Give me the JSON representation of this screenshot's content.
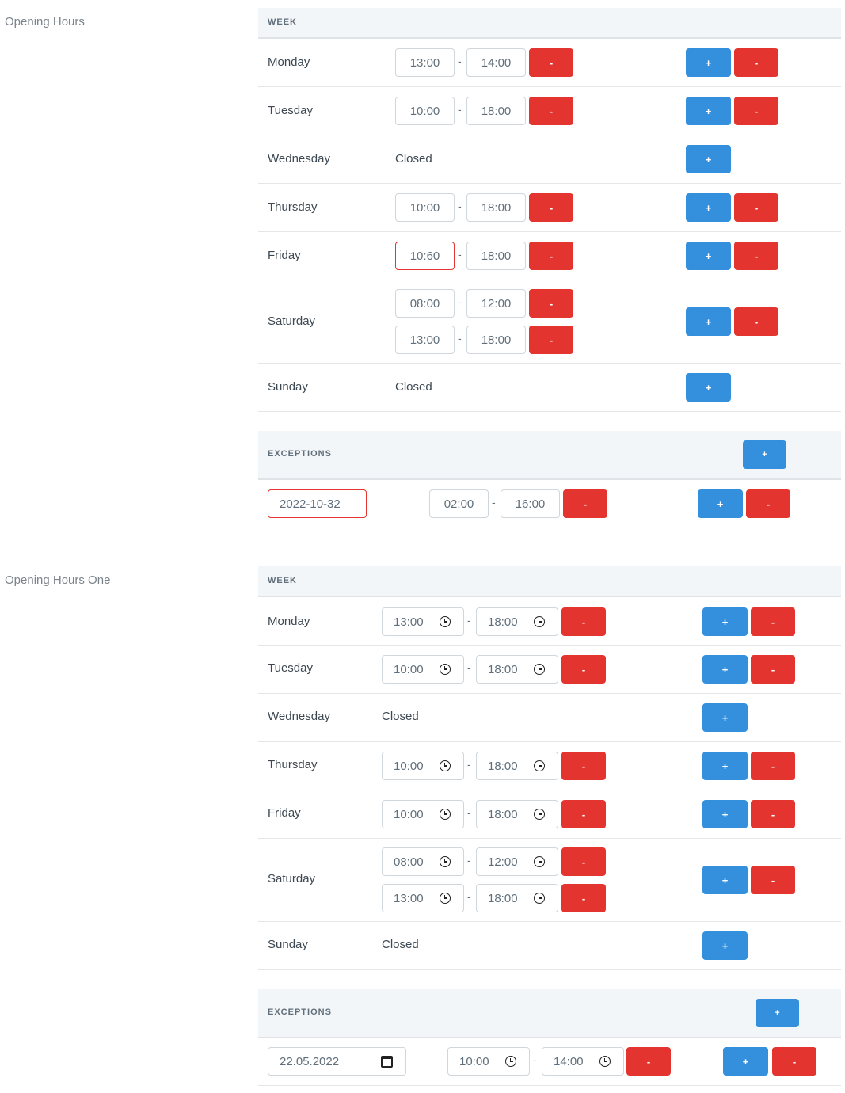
{
  "section1": {
    "label": "Opening Hours",
    "week_header": "WEEK",
    "exceptions_header": "EXCEPTIONS",
    "days": [
      {
        "name": "Monday",
        "slots": [
          {
            "from": "13:00",
            "to": "14:00"
          }
        ]
      },
      {
        "name": "Tuesday",
        "slots": [
          {
            "from": "10:00",
            "to": "18:00"
          }
        ]
      },
      {
        "name": "Wednesday",
        "closed": "Closed"
      },
      {
        "name": "Thursday",
        "slots": [
          {
            "from": "10:00",
            "to": "18:00"
          }
        ]
      },
      {
        "name": "Friday",
        "slots": [
          {
            "from": "10:60",
            "to": "18:00"
          }
        ]
      },
      {
        "name": "Saturday",
        "slots": [
          {
            "from": "08:00",
            "to": "12:00"
          },
          {
            "from": "13:00",
            "to": "18:00"
          }
        ]
      },
      {
        "name": "Sunday",
        "closed": "Closed"
      }
    ],
    "exception": {
      "date": "2022-10-32",
      "from": "02:00",
      "to": "16:00"
    }
  },
  "section2": {
    "label": "Opening Hours One",
    "week_header": "WEEK",
    "exceptions_header": "EXCEPTIONS",
    "days": [
      {
        "name": "Monday",
        "slots": [
          {
            "from": "13:00",
            "to": "18:00"
          }
        ]
      },
      {
        "name": "Tuesday",
        "slots": [
          {
            "from": "10:00",
            "to": "18:00"
          }
        ]
      },
      {
        "name": "Wednesday",
        "closed": "Closed"
      },
      {
        "name": "Thursday",
        "slots": [
          {
            "from": "10:00",
            "to": "18:00"
          }
        ]
      },
      {
        "name": "Friday",
        "slots": [
          {
            "from": "10:00",
            "to": "18:00"
          }
        ]
      },
      {
        "name": "Saturday",
        "slots": [
          {
            "from": "08:00",
            "to": "12:00"
          },
          {
            "from": "13:00",
            "to": "18:00"
          }
        ]
      },
      {
        "name": "Sunday",
        "closed": "Closed"
      }
    ],
    "exception": {
      "date": "22.05.2022",
      "from": "10:00",
      "to": "14:00"
    }
  },
  "buttons": {
    "add": "+",
    "remove": "-"
  },
  "dash": "-",
  "colors": {
    "add": "#3490dc",
    "remove": "#e3342f",
    "header_bg": "#f3f6f8",
    "error_border": "#e3342f"
  },
  "icons": {
    "time": "clock-icon",
    "date": "calendar-icon"
  }
}
